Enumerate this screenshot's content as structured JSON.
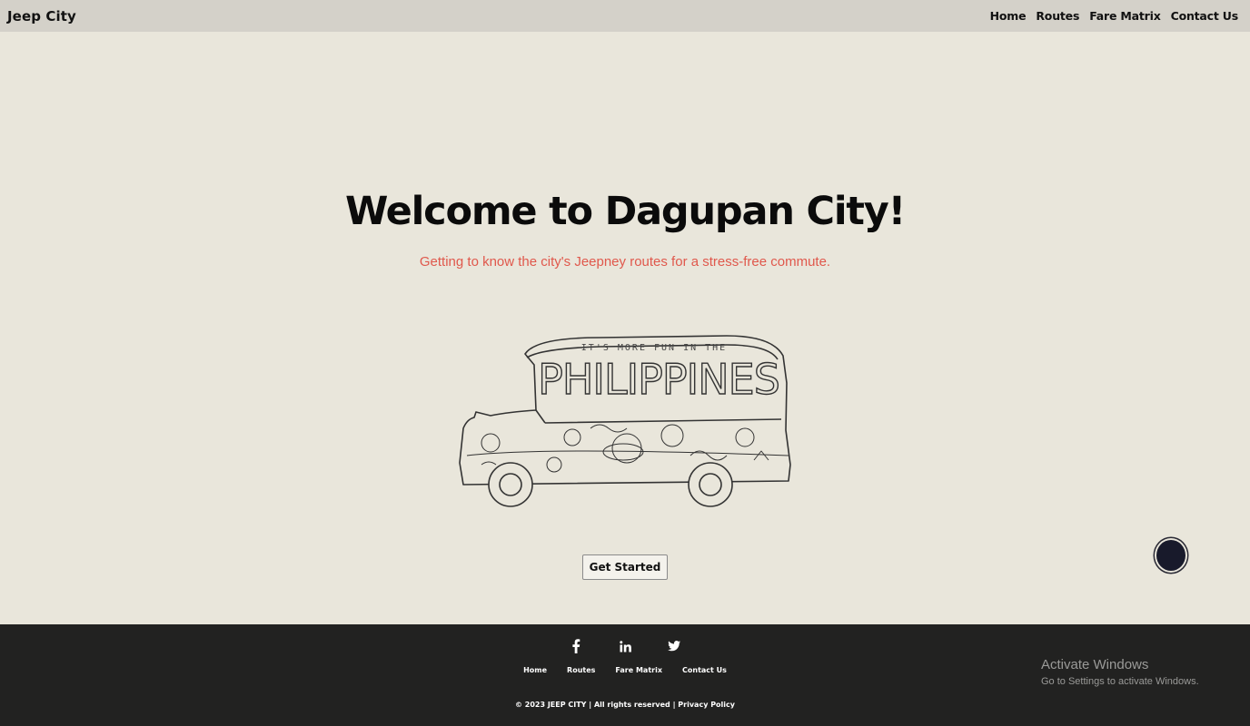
{
  "header": {
    "brand": "Jeep City",
    "nav": [
      "Home",
      "Routes",
      "Fare Matrix",
      "Contact Us"
    ]
  },
  "hero": {
    "title": "Welcome to Dagupan City!",
    "subtitle": "Getting to know the city's Jeepney routes for a stress-free commute.",
    "illustration_banner_small": "IT'S MORE FUN IN THE",
    "illustration_banner_big": "PHILIPPINES",
    "cta_label": "Get Started"
  },
  "footer": {
    "socials": [
      "facebook-icon",
      "linkedin-icon",
      "twitter-icon"
    ],
    "nav": [
      "Home",
      "Routes",
      "Fare Matrix",
      "Contact Us"
    ],
    "copyright": "© 2023 JEEP CITY | All rights reserved | ",
    "privacy": "Privacy Policy"
  },
  "os_overlay": {
    "line1": "Activate Windows",
    "line2": "Go to Settings to activate Windows."
  },
  "colors": {
    "page_bg": "#e9e6db",
    "header_bg": "#d4d1c9",
    "subtitle": "#e0584c",
    "footer_bg": "#222221",
    "fab": "#181a2b"
  }
}
